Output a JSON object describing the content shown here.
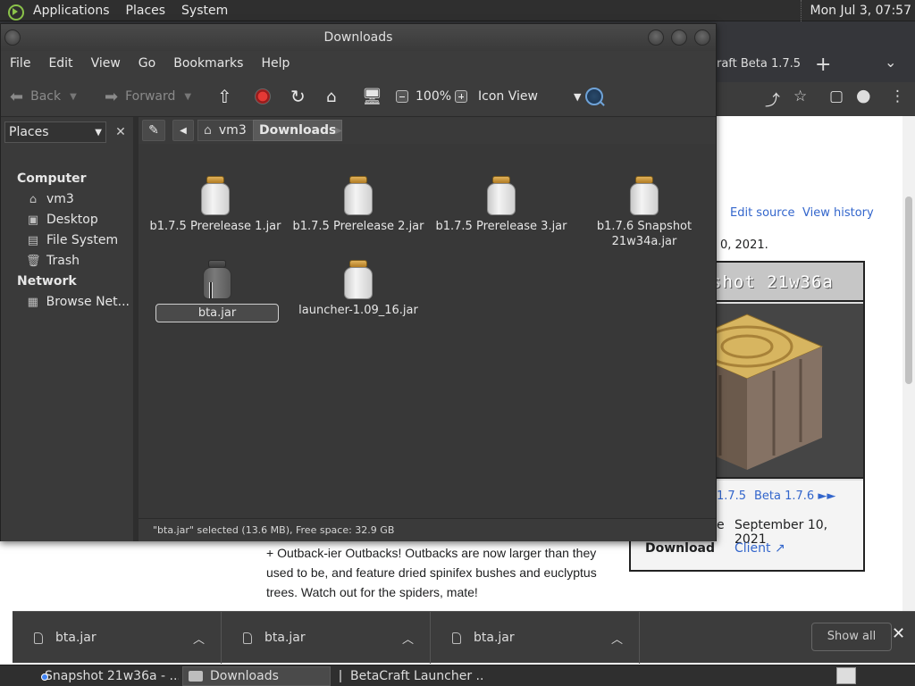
{
  "top_panel": {
    "menus": [
      "Applications",
      "Places",
      "System"
    ],
    "clock": "Mon Jul 3, 07:57"
  },
  "browser": {
    "tab_title": "raft Beta 1.7.5",
    "wiki": {
      "edit_source": "Edit source",
      "view_history": "View history",
      "date_fragment": "0, 2021.",
      "infobox_title": "shot 21w36a",
      "prev_version": "1.7.5",
      "next_version": "Beta 1.7.6 ►►",
      "release_label": "e",
      "release_date": "September 10, 2021",
      "download_label": "Download",
      "download_link": "Client",
      "paragraph": "+ Outback-ier Outbacks! Outbacks are now larger than they used to be, and feature dried spinifex bushes and euclyptus trees. Watch out for the spiders, mate!"
    }
  },
  "downloads_bar": {
    "items": [
      {
        "name": "bta.jar"
      },
      {
        "name": "bta.jar"
      },
      {
        "name": "bta.jar"
      }
    ],
    "show_all": "Show all"
  },
  "taskbar": {
    "tasks": [
      {
        "label": "Snapshot 21w36a - ..."
      },
      {
        "label": "Downloads"
      },
      {
        "label": "BetaCraft Launcher ..."
      }
    ]
  },
  "file_manager": {
    "title": "Downloads",
    "menu": [
      "File",
      "Edit",
      "View",
      "Go",
      "Bookmarks",
      "Help"
    ],
    "toolbar": {
      "back": "Back",
      "forward": "Forward",
      "zoom": "100%",
      "view_mode": "Icon View"
    },
    "side_pane": {
      "selector": "Places",
      "groups": [
        {
          "title": "Computer",
          "items": [
            {
              "label": "vm3",
              "icon": "home-folder-icon"
            },
            {
              "label": "Desktop",
              "icon": "desktop-icon"
            },
            {
              "label": "File System",
              "icon": "drive-icon"
            },
            {
              "label": "Trash",
              "icon": "trash-icon"
            }
          ]
        },
        {
          "title": "Network",
          "items": [
            {
              "label": "Browse Net...",
              "icon": "network-icon"
            }
          ]
        }
      ]
    },
    "location": {
      "crumbs": [
        "vm3",
        "Downloads"
      ]
    },
    "files": [
      {
        "name": "b1.7.5 Prerelease 1.jar"
      },
      {
        "name": "b1.7.5 Prerelease 2.jar"
      },
      {
        "name": "b1.7.5 Prerelease 3.jar"
      },
      {
        "name": "b1.7.6 Snapshot 21w34a.jar"
      },
      {
        "name": "bta.jar"
      },
      {
        "name": "launcher-1.09_16.jar"
      }
    ],
    "status": "\"bta.jar\" selected (13.6 MB), Free space: 32.9 GB"
  }
}
